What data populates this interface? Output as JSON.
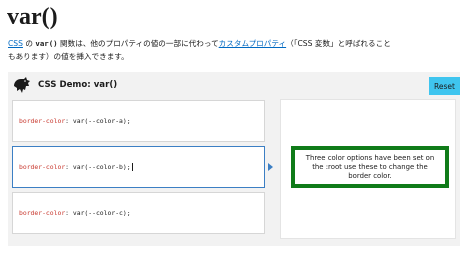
{
  "title": "var()",
  "intro": {
    "link_css": "CSS",
    "text_1": " の ",
    "code_fn": "var()",
    "text_2": " 関数は、他のプロパティの値の一部に代わって",
    "link_custom_props": "カスタムプロパティ",
    "text_3": "（「CSS 変数」と呼ばれることもあります）の値を挿入できます。"
  },
  "demo": {
    "title": "CSS Demo: var()",
    "reset_label": "Reset",
    "choices": [
      {
        "property": "border-color",
        "separator": ": ",
        "value": "var(--color-a);"
      },
      {
        "property": "border-color",
        "separator": ": ",
        "value": "var(--color-b);"
      },
      {
        "property": "border-color",
        "separator": ": ",
        "value": "var(--color-c);"
      }
    ],
    "selected_index": 1,
    "output_text": "Three color options have been set on the :root use these to change the border color."
  },
  "colors": {
    "accent_blue": "#3c7fc4",
    "reset_button": "#3fc5ef",
    "link": "#0069c2",
    "property_red": "#c8372d",
    "example_border": "#0f7b19"
  },
  "icons": {
    "logo": "mdn-dino-logo-icon",
    "selection_marker": "triangle-right-icon"
  }
}
